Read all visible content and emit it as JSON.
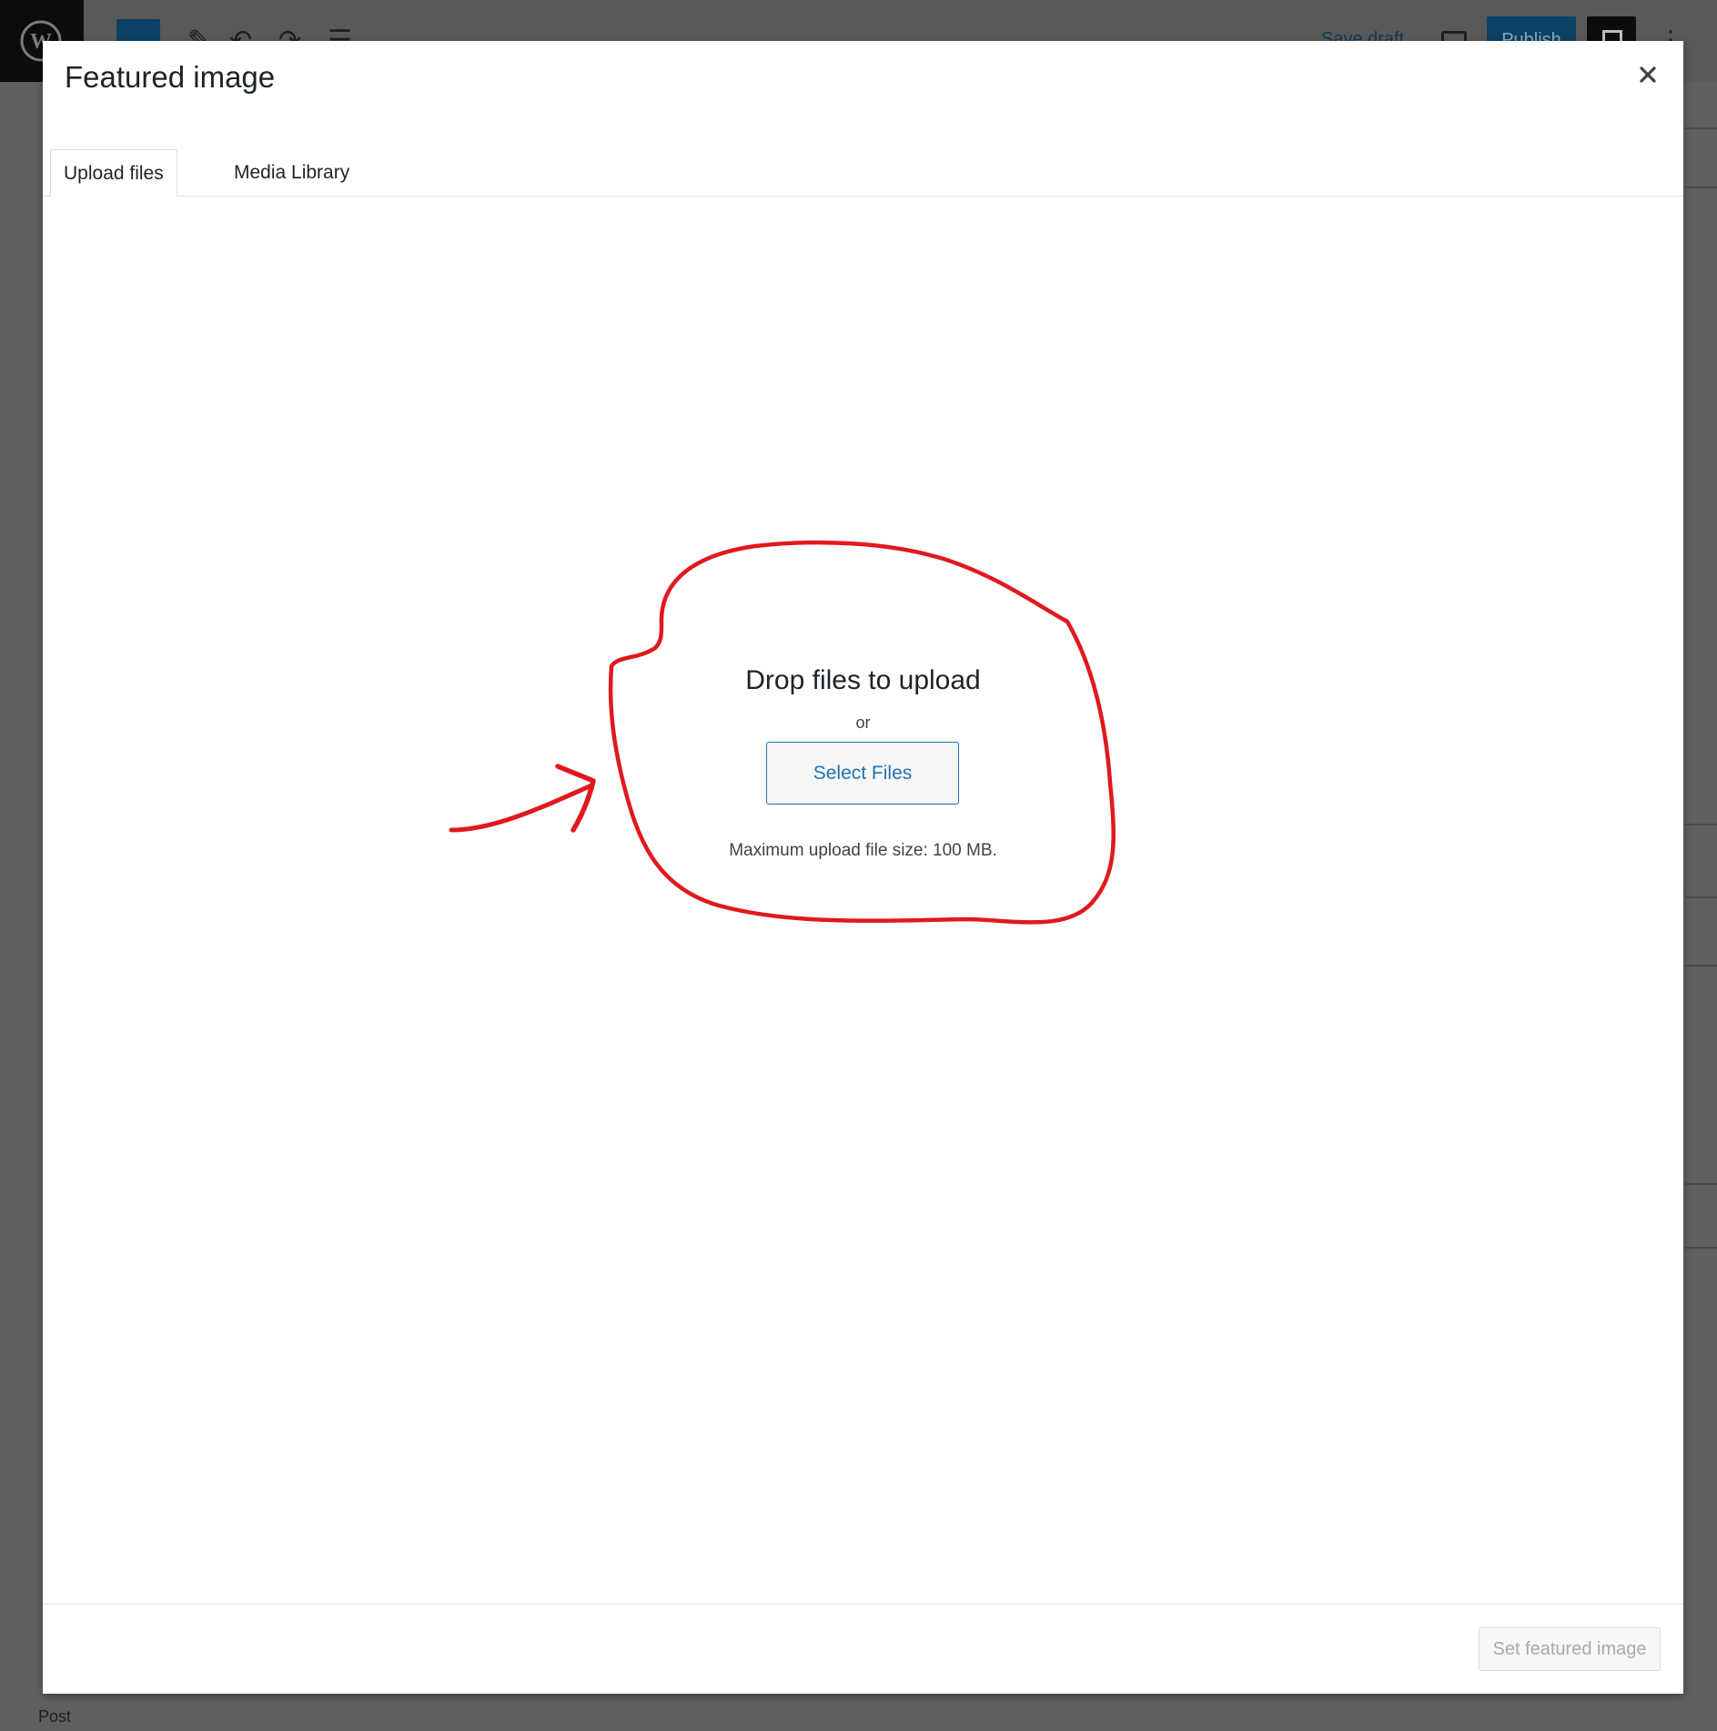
{
  "background": {
    "save_draft_label": "Save draft",
    "publish_label": "Publish",
    "footer_label": "Post"
  },
  "modal": {
    "title": "Featured image",
    "tabs": [
      {
        "label": "Upload files",
        "active": true
      },
      {
        "label": "Media Library",
        "active": false
      }
    ],
    "uploader": {
      "drop_title": "Drop files to upload",
      "or_text": "or",
      "select_button": "Select Files",
      "max_size_text": "Maximum upload file size: 100 MB."
    },
    "toolbar": {
      "set_button": "Set featured image"
    }
  },
  "icons": {
    "close": "close-icon",
    "logo": "wordpress-logo-icon"
  },
  "colors": {
    "accent": "#2271b1",
    "annotation": "#e0191e",
    "overlay": "#5f5f5f"
  }
}
